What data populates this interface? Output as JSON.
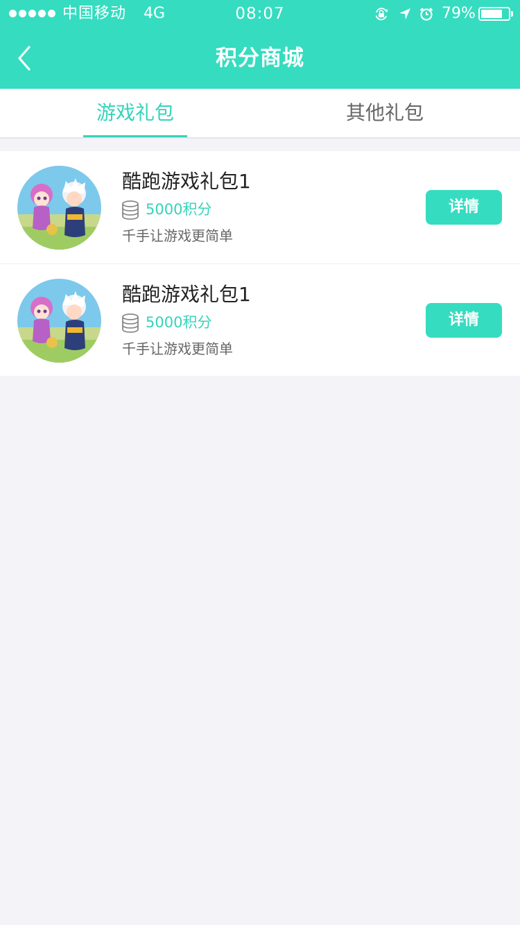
{
  "status_bar": {
    "carrier": "中国移动",
    "network": "4G",
    "time": "08:07",
    "battery_percent": "79%",
    "battery_level": 0.79,
    "icons": [
      "signal-dots-icon",
      "rotation-lock-icon",
      "location-arrow-icon",
      "alarm-clock-icon",
      "battery-icon"
    ]
  },
  "nav": {
    "title": "积分商城",
    "back_icon": "chevron-left-icon"
  },
  "tabs": [
    {
      "label": "游戏礼包",
      "active": true
    },
    {
      "label": "其他礼包",
      "active": false
    }
  ],
  "gifts": [
    {
      "title": "酷跑游戏礼包1",
      "points": "5000积分",
      "description": "千手让游戏更简单",
      "button": "详情"
    },
    {
      "title": "酷跑游戏礼包1",
      "points": "5000积分",
      "description": "千手让游戏更简单",
      "button": "详情"
    }
  ],
  "colors": {
    "accent": "#35dcc0",
    "accent_text": "#35d3ba",
    "background": "#f4f4f8"
  }
}
